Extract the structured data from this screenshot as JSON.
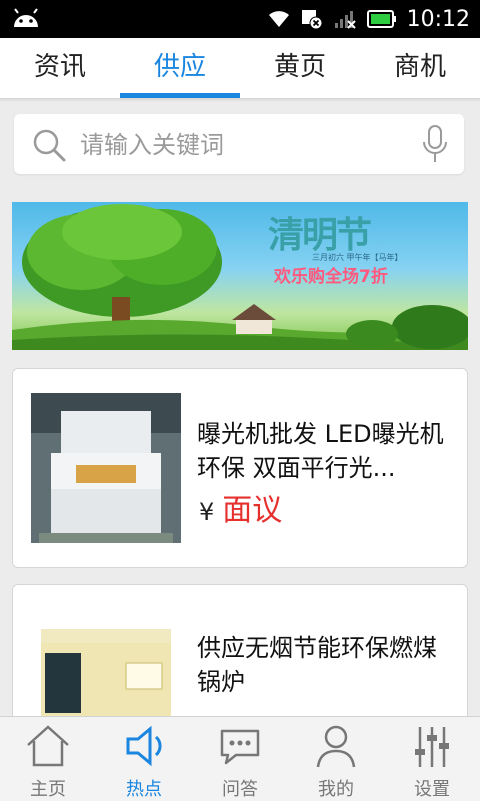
{
  "status_bar": {
    "time": "10:12"
  },
  "tabs": [
    {
      "label": "资讯",
      "active": false
    },
    {
      "label": "供应",
      "active": true
    },
    {
      "label": "黄页",
      "active": false
    },
    {
      "label": "商机",
      "active": false
    }
  ],
  "search": {
    "placeholder": "请输入关键词"
  },
  "banner": {
    "title": "清明节",
    "subtitle": "欢乐购全场7折",
    "fine_print": "三月初六 甲午年【马年】"
  },
  "listings": [
    {
      "title": "曝光机批发 LED曝光机环保 双面平行光...",
      "currency": "¥",
      "price": "面议"
    },
    {
      "title": "供应无烟节能环保燃煤锅炉"
    }
  ],
  "bottom_nav": [
    {
      "label": "主页",
      "icon": "home-icon",
      "active": false
    },
    {
      "label": "热点",
      "icon": "speaker-icon",
      "active": true
    },
    {
      "label": "问答",
      "icon": "chat-icon",
      "active": false
    },
    {
      "label": "我的",
      "icon": "user-icon",
      "active": false
    },
    {
      "label": "设置",
      "icon": "sliders-icon",
      "active": false
    }
  ],
  "colors": {
    "accent": "#1a86e0",
    "price": "#e5302e"
  }
}
